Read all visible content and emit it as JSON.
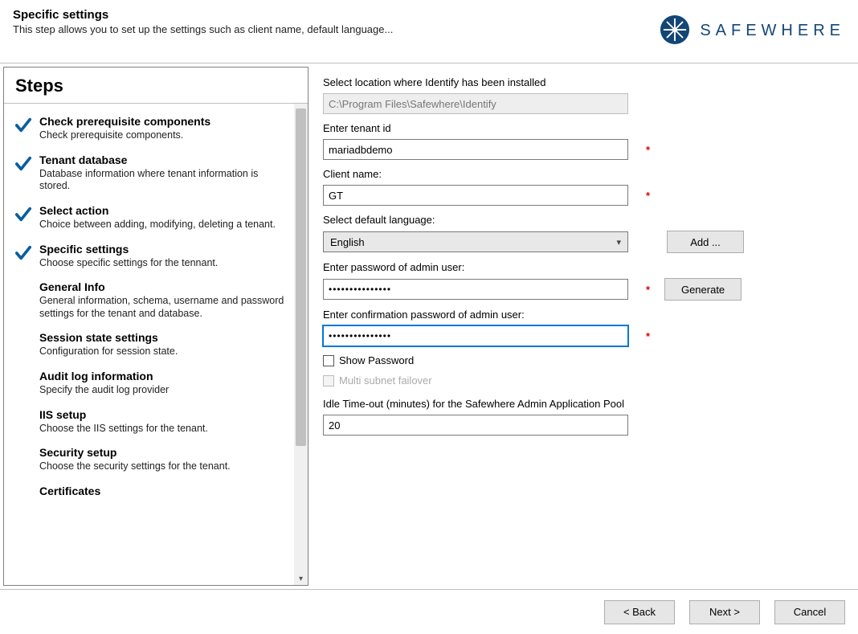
{
  "header": {
    "title": "Specific settings",
    "subtitle": "This step allows you to set up the settings such as client name, default language..."
  },
  "logo": {
    "text": "SAFEWHERE",
    "icon": "snowflake-icon",
    "color": "#124676"
  },
  "sidebar": {
    "title": "Steps",
    "items": [
      {
        "title": "Check prerequisite components",
        "desc": "Check prerequisite components.",
        "done": true
      },
      {
        "title": "Tenant database",
        "desc": "Database information where tenant information is stored.",
        "done": true
      },
      {
        "title": "Select action",
        "desc": "Choice between adding, modifying, deleting a tenant.",
        "done": true
      },
      {
        "title": "Specific settings",
        "desc": "Choose specific settings for the tennant.",
        "done": true
      },
      {
        "title": "General Info",
        "desc": "General information, schema, username and password settings for the tenant and database.",
        "done": false
      },
      {
        "title": "Session state settings",
        "desc": "Configuration for session state.",
        "done": false
      },
      {
        "title": "Audit log information",
        "desc": "Specify the audit log provider",
        "done": false
      },
      {
        "title": "IIS setup",
        "desc": "Choose the IIS settings for the tenant.",
        "done": false
      },
      {
        "title": "Security setup",
        "desc": "Choose the security settings for the tenant.",
        "done": false
      },
      {
        "title": "Certificates",
        "desc": "",
        "done": false
      }
    ]
  },
  "form": {
    "install_location_label": "Select location where Identify has been installed",
    "install_location_value": "C:\\Program Files\\Safewhere\\Identify",
    "tenant_id_label": "Enter tenant id",
    "tenant_id_value": "mariadbdemo",
    "client_name_label": "Client name:",
    "client_name_value": "GT",
    "language_label": "Select default language:",
    "language_value": "English",
    "add_btn": "Add ...",
    "admin_pwd_label": "Enter password of admin user:",
    "admin_pwd_value": "•••••••••••••••",
    "generate_btn": "Generate",
    "admin_pwd_confirm_label": "Enter confirmation password of admin user:",
    "admin_pwd_confirm_value": "•••••••••••••••",
    "show_password_label": "Show Password",
    "multi_subnet_label": "Multi subnet failover",
    "idle_timeout_label": "Idle Time-out (minutes) for the Safewhere Admin Application Pool",
    "idle_timeout_value": "20",
    "required_marker": "*"
  },
  "footer": {
    "back": "< Back",
    "next": "Next >",
    "cancel": "Cancel"
  }
}
